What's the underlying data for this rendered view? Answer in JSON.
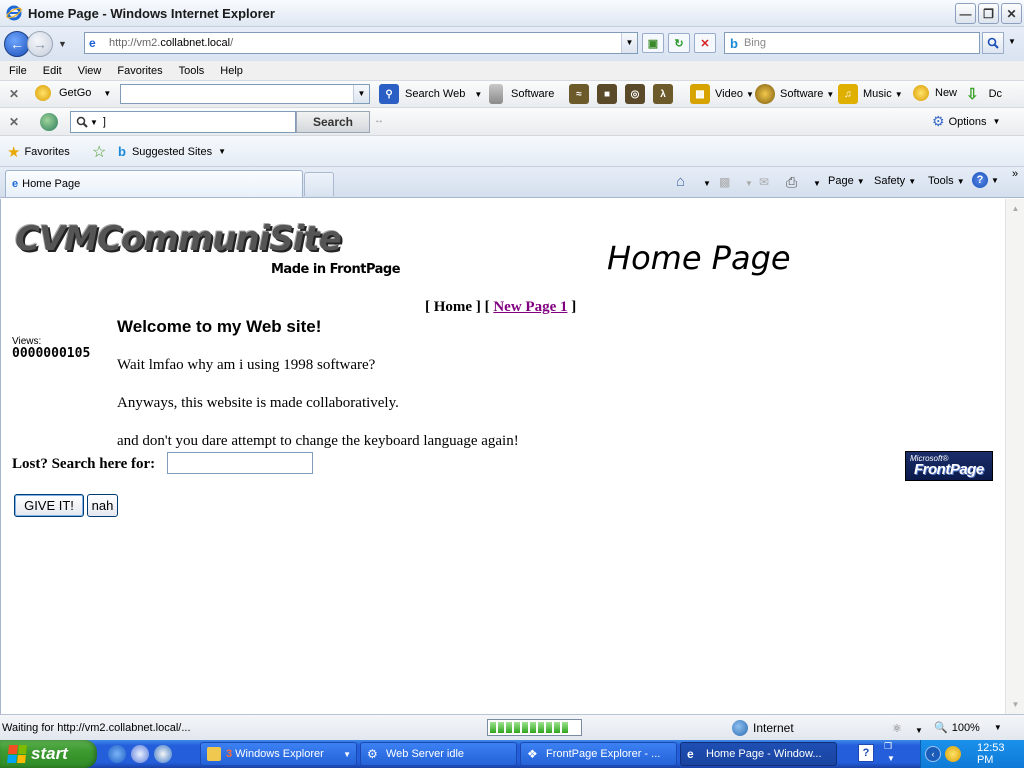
{
  "window": {
    "title": "Home Page - Windows Internet Explorer"
  },
  "address_bar": {
    "url_prefix": "http://vm2.",
    "url_host": "collabnet.local",
    "url_suffix": "/",
    "search_placeholder": "Bing"
  },
  "menu": [
    "File",
    "Edit",
    "View",
    "Favorites",
    "Tools",
    "Help"
  ],
  "getgo_toolbar": {
    "getgo_label": "GetGo",
    "search_web_label": "Search Web",
    "software_label": "Software",
    "video_label": "Video",
    "software2_label": "Software",
    "music_label": "Music",
    "new_label": "New",
    "cut_label": "Dc"
  },
  "search_toolbar": {
    "input_value": "]",
    "search_button": "Search",
    "options_label": "Options"
  },
  "favorites_bar": {
    "favorites_label": "Favorites",
    "suggested_sites_label": "Suggested Sites"
  },
  "tabs": {
    "active_tab_label": "Home Page",
    "page_menu": "Page",
    "safety_menu": "Safety",
    "tools_menu": "Tools"
  },
  "page": {
    "logo_text": "CVMCommuniSite",
    "logo_sub": "Made in FrontPage",
    "heading": "Home Page",
    "nav_home": "Home",
    "nav_new_page": "New Page 1",
    "views_label": "Views:",
    "views_count": "0000000105",
    "welcome_title": "Welcome to my Web site!",
    "paragraphs": [
      "Wait lmfao why am i using 1998 software?",
      "Anyways, this website is made collaboratively.",
      "and don't you dare attempt to change the keyboard language again!"
    ],
    "search_label": "Lost? Search here for:",
    "search_value": "",
    "give_button": "GIVE IT!",
    "nah_button": "nah",
    "fp_badge_top": "Microsoft®",
    "fp_badge_main": "FrontPage"
  },
  "status_bar": {
    "status_text": "Waiting for http://vm2.collabnet.local/...",
    "progress_fraction": 0.95,
    "zone_label": "Internet",
    "zoom_label": "100%"
  },
  "taskbar": {
    "start_label": "start",
    "tasks": [
      {
        "label": "Windows Explorer",
        "count": "3"
      },
      {
        "label": "Web Server idle"
      },
      {
        "label": "FrontPage Explorer - ..."
      },
      {
        "label": "Home Page - Window..."
      }
    ],
    "clock": "12:53 PM"
  },
  "colors": {
    "visited_link": "#800080",
    "taskbar_blue": "#245edb",
    "start_green": "#3c9a31"
  }
}
